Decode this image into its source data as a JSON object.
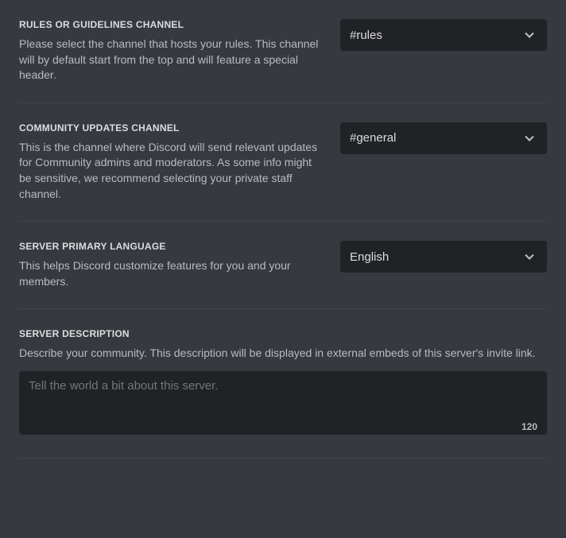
{
  "sections": {
    "rules": {
      "title": "Rules or Guidelines Channel",
      "description": "Please select the channel that hosts your rules. This channel will by default start from the top and will feature a special header.",
      "value": "#rules"
    },
    "updates": {
      "title": "Community Updates Channel",
      "description": "This is the channel where Discord will send relevant updates for Community admins and moderators. As some info might be sensitive, we recommend selecting your private staff channel.",
      "value": "#general"
    },
    "language": {
      "title": "Server Primary Language",
      "description": "This helps Discord customize features for you and your members.",
      "value": "English"
    },
    "desc": {
      "title": "Server Description",
      "description": "Describe your community. This description will be displayed in external embeds of this server's invite link.",
      "placeholder": "Tell the world a bit about this server.",
      "charLimit": "120"
    }
  }
}
